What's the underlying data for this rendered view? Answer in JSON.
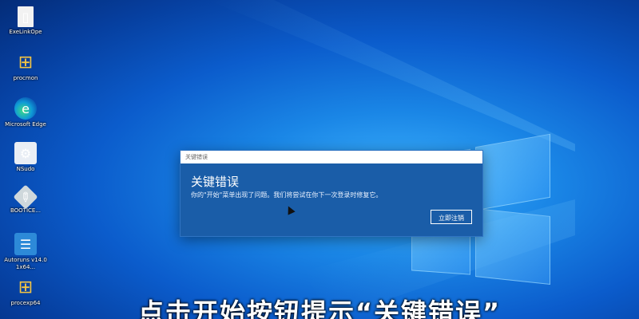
{
  "desktop": {
    "icons": [
      {
        "label": "ExeLinkOpe",
        "glyph": "▯"
      },
      {
        "label": "procmon",
        "glyph": "⊞"
      },
      {
        "label": "Microsoft Edge",
        "glyph": "e"
      },
      {
        "label": "NSudo",
        "glyph": "⚙"
      },
      {
        "label": "BOOTICE...",
        "glyph": "✎"
      },
      {
        "label": "Autoruns v14.01x64...",
        "glyph": "☰"
      },
      {
        "label": "procexp64",
        "glyph": "⊞"
      }
    ]
  },
  "dialog": {
    "window_title": "关键错误",
    "heading": "关键错误",
    "message": "你的\"开始\"菜单出现了问题。我们将尝试在你下一次登录时修复它。",
    "button_label": "立即注销"
  },
  "subtitle": "点击开始按钮提示“关键错误”"
}
